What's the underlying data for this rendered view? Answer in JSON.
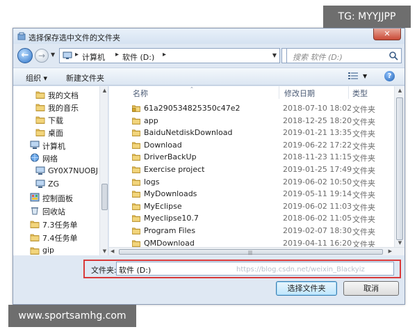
{
  "window": {
    "title": "选择保存选中文件的文件夹",
    "close_label": "✕"
  },
  "address": {
    "crumbs": [
      "计算机",
      "软件 (D:)"
    ],
    "search_placeholder": "搜索 软件 (D:)"
  },
  "toolbar": {
    "organize_label": "组织 ▾",
    "new_folder_label": "新建文件夹"
  },
  "nav": {
    "items": [
      {
        "label": "我的文档",
        "icon": "folder-icon"
      },
      {
        "label": "我的音乐",
        "icon": "folder-icon"
      },
      {
        "label": "下载",
        "icon": "folder-icon"
      },
      {
        "label": "桌面",
        "icon": "folder-icon"
      },
      {
        "label": "计算机",
        "icon": "computer-icon"
      },
      {
        "label": "网络",
        "icon": "network-icon"
      },
      {
        "label": "GY0X7NUOBJ",
        "icon": "computer-icon"
      },
      {
        "label": "ZG",
        "icon": "computer-icon"
      },
      {
        "label": "控制面板",
        "icon": "control-panel-icon"
      },
      {
        "label": "回收站",
        "icon": "recycle-bin-icon"
      },
      {
        "label": "7.3任务单",
        "icon": "folder-icon"
      },
      {
        "label": "7.4任务单",
        "icon": "folder-icon"
      },
      {
        "label": "gip",
        "icon": "folder-icon"
      }
    ]
  },
  "files": {
    "headers": {
      "name": "名称",
      "date": "修改日期",
      "type": "类型"
    },
    "rows": [
      {
        "name": "61a290534825350c47e2",
        "date": "2018-07-10 18:02",
        "type": "文件夹",
        "locked": true
      },
      {
        "name": "app",
        "date": "2018-12-25 18:20",
        "type": "文件夹"
      },
      {
        "name": "BaiduNetdiskDownload",
        "date": "2019-01-21 13:35",
        "type": "文件夹"
      },
      {
        "name": "Download",
        "date": "2019-06-22 17:22",
        "type": "文件夹"
      },
      {
        "name": "DriverBackUp",
        "date": "2018-11-23 11:15",
        "type": "文件夹"
      },
      {
        "name": "Exercise project",
        "date": "2019-01-25 17:49",
        "type": "文件夹"
      },
      {
        "name": "logs",
        "date": "2019-06-02 10:50",
        "type": "文件夹"
      },
      {
        "name": "MyDownloads",
        "date": "2019-05-11 19:14",
        "type": "文件夹"
      },
      {
        "name": "MyEclipse",
        "date": "2019-06-02 11:03",
        "type": "文件夹"
      },
      {
        "name": "Myeclipse10.7",
        "date": "2018-06-02 11:05",
        "type": "文件夹"
      },
      {
        "name": "Program Files",
        "date": "2019-02-07 18:30",
        "type": "文件夹"
      },
      {
        "name": "QMDownload",
        "date": "2019-04-11 16:20",
        "type": "文件夹"
      }
    ]
  },
  "footer": {
    "folder_label": "文件夹:",
    "folder_value": "软件 (D:)",
    "select_button": "选择文件夹",
    "cancel_button": "取消",
    "csdn_watermark": "https://blog.csdn.net/weixin_Blackyiz"
  },
  "overlays": {
    "tg": "TG: MYYJJPP",
    "site": "www.sportsamhg.com"
  },
  "colors": {
    "highlight_border": "#d93a3a",
    "folder": "#e8c460",
    "accent": "#2b72c8"
  }
}
